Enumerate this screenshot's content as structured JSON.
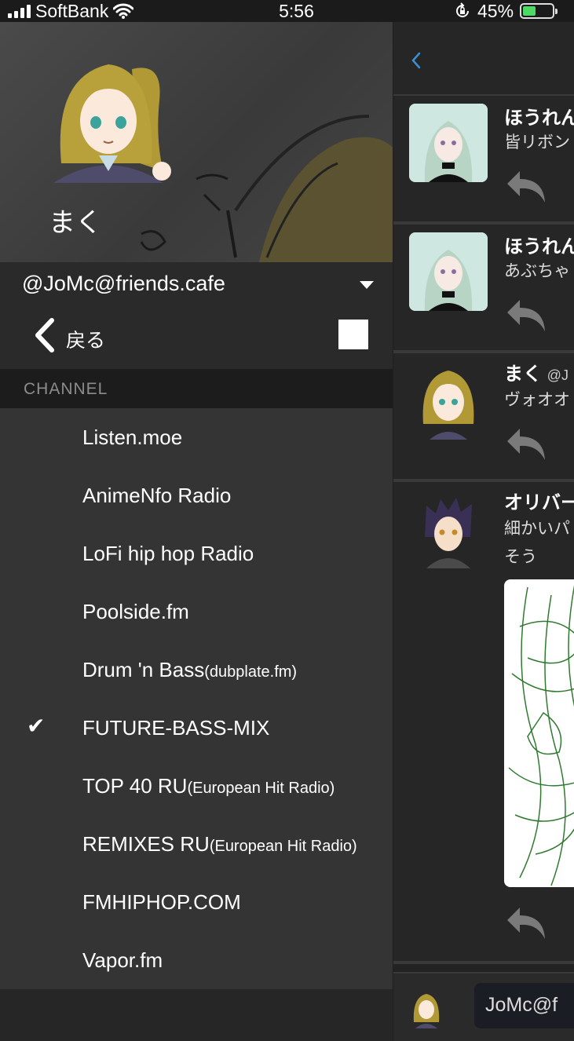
{
  "status_bar": {
    "carrier": "SoftBank",
    "time": "5:56",
    "battery_percent": "45%",
    "battery_level": 0.45,
    "icons": [
      "signal-bars-icon",
      "wifi-icon",
      "rotation-lock-icon",
      "battery-icon"
    ]
  },
  "drawer": {
    "profile": {
      "display_name": "まく",
      "account": "@JoMc@friends.cafe"
    },
    "back_label": "戻る",
    "section_title": "CHANNEL",
    "channels": [
      {
        "name": "Listen.moe",
        "sub": "",
        "selected": false
      },
      {
        "name": "AnimeNfo Radio",
        "sub": "",
        "selected": false
      },
      {
        "name": "LoFi hip hop Radio",
        "sub": "",
        "selected": false
      },
      {
        "name": "Poolside.fm",
        "sub": "",
        "selected": false
      },
      {
        "name": "Drum 'n Bass",
        "sub": "(dubplate.fm)",
        "selected": false
      },
      {
        "name": "FUTURE-BASS-MIX",
        "sub": "",
        "selected": true
      },
      {
        "name": "TOP 40 RU",
        "sub": "(European Hit Radio)",
        "selected": false
      },
      {
        "name": "REMIXES RU",
        "sub": "(European Hit Radio)",
        "selected": false
      },
      {
        "name": "FMHIPHOP.COM",
        "sub": "",
        "selected": false
      },
      {
        "name": "Vapor.fm",
        "sub": "",
        "selected": false
      }
    ],
    "check_mark": "✔"
  },
  "timeline": {
    "posts": [
      {
        "author": "ほうれん",
        "acct": "",
        "text": [
          "皆リボン"
        ]
      },
      {
        "author": "ほうれん",
        "acct": "",
        "text": [
          "あぶちゃ"
        ]
      },
      {
        "author": "まく",
        "acct": "@J",
        "text": [
          "ヴォオオ"
        ]
      },
      {
        "author": "オリバー",
        "acct": "",
        "text": [
          "細かいパ",
          "そう"
        ]
      }
    ],
    "compose_account": "JoMc@f"
  },
  "colors": {
    "drawer_bg": "#343434",
    "section_bg": "#1c1c1c",
    "accent_blue": "#3a8fd6",
    "battery_green": "#4cd964"
  }
}
